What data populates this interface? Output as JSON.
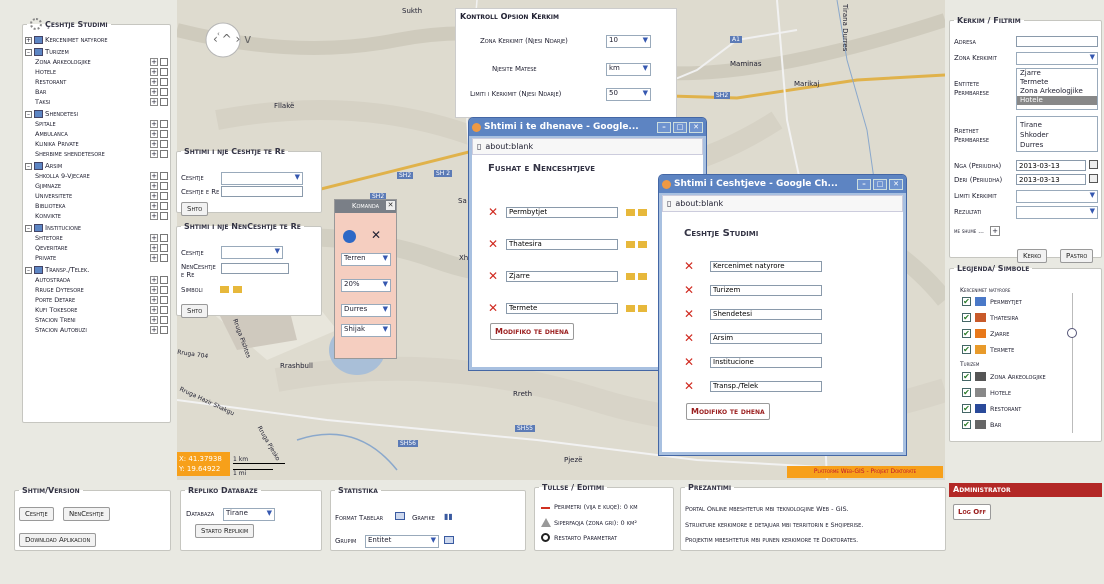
{
  "map": {
    "places": [
      "Sukth",
      "Fllakë",
      "Maminas",
      "Marikaj",
      "Rrashbull",
      "Rreth",
      "Pjezë",
      "SH2",
      "SH 2",
      "SH2",
      "SH56",
      "SH55",
      "SH2",
      "A1",
      "Tirana Durres",
      "Sa",
      "Xh"
    ],
    "roads": [
      "Rruga 704",
      "Rruga Hazir Shakgu",
      "Rruga Pishtes",
      "Rruga Pjesko"
    ],
    "coords": "X: 41.37938\nY: 19.64922",
    "coord_x": "X: 41.37938",
    "coord_y": "Y: 19.64922",
    "scale_km": "1 km",
    "scale_mi": "1 mi",
    "banner": "Platforme Web-GIS - Projekt Doktorate"
  },
  "left": {
    "title": "Çeshtje Studimi",
    "cats": [
      {
        "label": "Kercenimet natyrore",
        "items": []
      },
      {
        "label": "Turizem",
        "items": [
          "Zona Arkeologjike",
          "Hotele",
          "Restorant",
          "Bar",
          "Taksi"
        ]
      },
      {
        "label": "Shendetesi",
        "items": [
          "Spitale",
          "Ambulanca",
          "Klinika Private",
          "Sherbime shendetesore"
        ]
      },
      {
        "label": "Arsim",
        "items": [
          "Shkolla 9-Vjecare",
          "Gjimnaze",
          "Universitete",
          "Biblioteka",
          "Konvikte"
        ]
      },
      {
        "label": "Institucione",
        "items": [
          "Shtetore",
          "Qeveritare",
          "Private"
        ]
      },
      {
        "label": "Transp./Telek.",
        "items": [
          "Autostrada",
          "Rruge Dytesore",
          "Porte Detare",
          "Kufi Tokesore",
          "Stacion Treni",
          "Stacion Autobuzi"
        ]
      }
    ]
  },
  "shto1": {
    "title": "Shtimi i nje Ceshtje te Re",
    "l1": "Ceshtje",
    "l2": "Ceshtje e Re",
    "btn": "Shto"
  },
  "shto2": {
    "title": "Shtimi i nje NenCeshtje te Re",
    "l1": "Ceshtje",
    "l2": "NenCeshtje e Re",
    "l3": "Simboli",
    "btn": "Shto"
  },
  "komanda": {
    "title": "Komanda",
    "s1": "Terren",
    "s2": "20%",
    "s3": "Durres",
    "s4": "Shijak"
  },
  "kontroll": {
    "title": "Kontroll Opsion Kerkim",
    "r1l": "Zona Kerkimit (Njesi Ndarje)",
    "r1v": "10",
    "r2l": "Njesite Matese",
    "r2v": "km",
    "r3l": "Limiti i Kerkimit (Njesi Ndarje)",
    "r3v": "50"
  },
  "w1": {
    "title": "Shtimi i te dhenave - Google...",
    "addr": "about:blank",
    "head": "Fushat e Nenceshtjeve",
    "fields": [
      "Permbytjet",
      "Thatesira",
      "Zjarre",
      "Termete"
    ],
    "btn": "Modifiko te dhena"
  },
  "w2": {
    "title": "Shtimi i Ceshtjeve - Google Ch...",
    "addr": "about:blank",
    "head": "Ceshtje Studimi",
    "fields": [
      "Kercenimet natyrore",
      "Turizem",
      "Shendetesi",
      "Arsim",
      "Institucione",
      "Transp./Telek"
    ],
    "btn": "Modifiko te dhena"
  },
  "kerkim": {
    "title": "Kerkim / Filtrim",
    "adresa": "Adresa",
    "zona": "Zona Kerkimit",
    "entitete": "Entitete Permbarese",
    "ent_list": [
      "Zjarre",
      "Termete",
      "Zona Arkeologjike",
      "Hotele"
    ],
    "rrethet": "Rrethet Permbarese",
    "rr_list": [
      "Tirane",
      "Shkoder",
      "Durres"
    ],
    "nga": "Nga (Periudha)",
    "nga_v": "2013-03-13",
    "deri": "Deri (Periudha)",
    "deri_v": "2013-03-13",
    "limiti": "Limiti Kerkimit",
    "rezultati": "Rezultati",
    "me_shume": "me shume ...",
    "b1": "Kerko",
    "b2": "Pastro"
  },
  "legjenda": {
    "title": "Legjenda/ Simbole",
    "g1": "Kercenimet natyrore",
    "g1i": [
      "Permbytjet",
      "Thatesira",
      "Zjarre",
      "Termete"
    ],
    "g2": "Turizem",
    "g2i": [
      "Zona Arkeologjike",
      "Hotele",
      "Restorant",
      "Bar"
    ]
  },
  "bottom": {
    "shtim": {
      "title": "Shtim/Version",
      "b1": "Ceshtje",
      "b2": "NenCeshtje",
      "b3": "Download Aplikacion"
    },
    "repliko": {
      "title": "Repliko Databaze",
      "l": "Databaza",
      "v": "Tirane",
      "b": "Starto Replikim"
    },
    "stat": {
      "title": "Statistika",
      "l1": "Format Tabelar",
      "l2": "Grafike",
      "l3": "Grupim",
      "v": "Entitet"
    },
    "tullse": {
      "title": "Tullse / Editimi",
      "r1": "Perimetri (vija e kuqe): 0 km",
      "r2": "Siperfaqja (zona gri): 0 km²",
      "r3": "Restarto Parametrat"
    },
    "prez": {
      "title": "Prezantimi",
      "l1": "Portal Online mbeshtetur mbi teknologjine Web - GIS.",
      "l2": "Strukture kerkimore e detajuar mbi territorin e Shqiperise.",
      "l3": "Projektim mbeshtetur mbi punen kerkimore te Doktorates."
    },
    "admin": {
      "title": "Administrator",
      "btn": "Log Off"
    }
  }
}
